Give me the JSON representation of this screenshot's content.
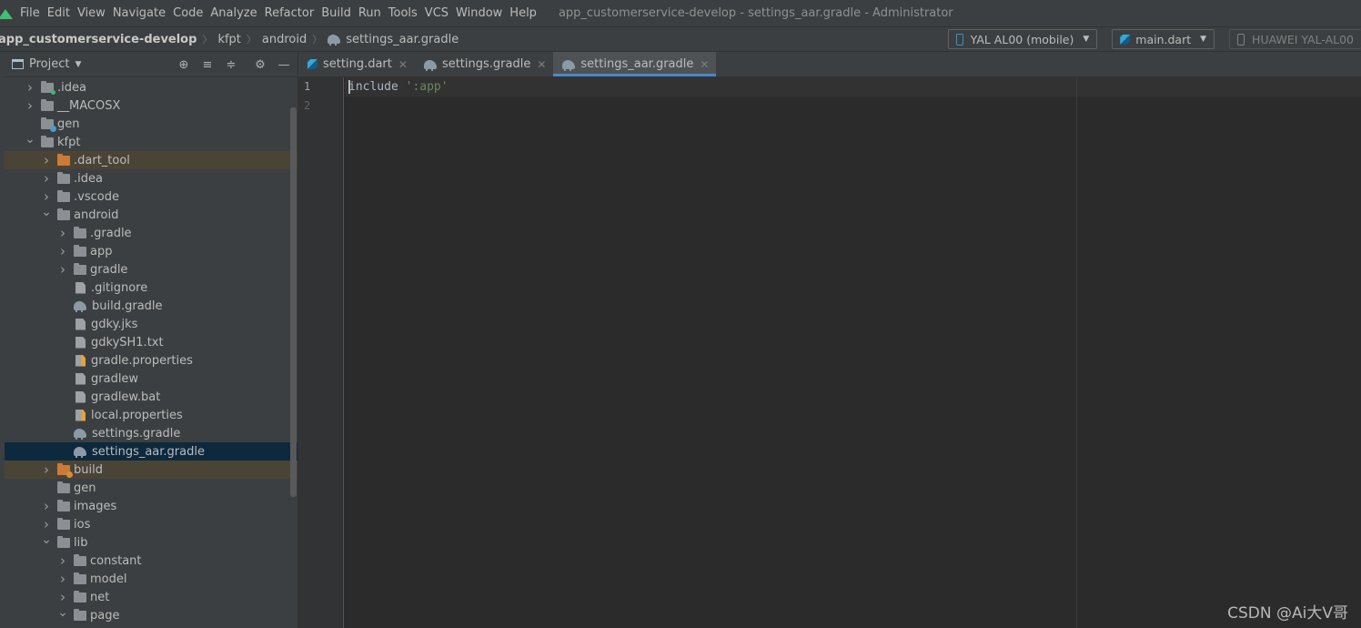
{
  "menubar": {
    "items": [
      "File",
      "Edit",
      "View",
      "Navigate",
      "Code",
      "Analyze",
      "Refactor",
      "Build",
      "Run",
      "Tools",
      "VCS",
      "Window",
      "Help"
    ],
    "window_title": "app_customerservice-develop - settings_aar.gradle - Administrator"
  },
  "navbar": {
    "crumbs": [
      "app_customerservice-develop",
      "kfpt",
      "android",
      "settings_aar.gradle"
    ],
    "device_select": "YAL AL00 (mobile)",
    "run_config": "main.dart",
    "device_label": "HUAWEI YAL-AL00"
  },
  "project_panel": {
    "title": "Project",
    "tree": [
      {
        "label": ".idea",
        "depth": 1,
        "expander": "collapsed",
        "icon": "folder-idea"
      },
      {
        "label": "__MACOSX",
        "depth": 1,
        "expander": "collapsed",
        "icon": "folder"
      },
      {
        "label": "gen",
        "depth": 1,
        "expander": "none",
        "icon": "folder-gen"
      },
      {
        "label": "kfpt",
        "depth": 1,
        "expander": "expanded",
        "icon": "folder"
      },
      {
        "label": ".dart_tool",
        "depth": 2,
        "expander": "collapsed",
        "icon": "folder-orange",
        "highlight": "brown"
      },
      {
        "label": ".idea",
        "depth": 2,
        "expander": "collapsed",
        "icon": "folder"
      },
      {
        "label": ".vscode",
        "depth": 2,
        "expander": "collapsed",
        "icon": "folder"
      },
      {
        "label": "android",
        "depth": 2,
        "expander": "expanded",
        "icon": "folder"
      },
      {
        "label": ".gradle",
        "depth": 3,
        "expander": "collapsed",
        "icon": "folder"
      },
      {
        "label": "app",
        "depth": 3,
        "expander": "collapsed",
        "icon": "folder"
      },
      {
        "label": "gradle",
        "depth": 3,
        "expander": "collapsed",
        "icon": "folder"
      },
      {
        "label": ".gitignore",
        "depth": 3,
        "expander": "none",
        "icon": "file"
      },
      {
        "label": "build.gradle",
        "depth": 3,
        "expander": "none",
        "icon": "gradle"
      },
      {
        "label": "gdky.jks",
        "depth": 3,
        "expander": "none",
        "icon": "file"
      },
      {
        "label": "gdkySH1.txt",
        "depth": 3,
        "expander": "none",
        "icon": "file"
      },
      {
        "label": "gradle.properties",
        "depth": 3,
        "expander": "none",
        "icon": "file-props"
      },
      {
        "label": "gradlew",
        "depth": 3,
        "expander": "none",
        "icon": "file"
      },
      {
        "label": "gradlew.bat",
        "depth": 3,
        "expander": "none",
        "icon": "file"
      },
      {
        "label": "local.properties",
        "depth": 3,
        "expander": "none",
        "icon": "file-props"
      },
      {
        "label": "settings.gradle",
        "depth": 3,
        "expander": "none",
        "icon": "gradle"
      },
      {
        "label": "settings_aar.gradle",
        "depth": 3,
        "expander": "none",
        "icon": "gradle",
        "highlight": "blue"
      },
      {
        "label": "build",
        "depth": 2,
        "expander": "collapsed",
        "icon": "folder-build",
        "highlight": "brown"
      },
      {
        "label": "gen",
        "depth": 2,
        "expander": "none",
        "icon": "folder"
      },
      {
        "label": "images",
        "depth": 2,
        "expander": "collapsed",
        "icon": "folder"
      },
      {
        "label": "ios",
        "depth": 2,
        "expander": "collapsed",
        "icon": "folder"
      },
      {
        "label": "lib",
        "depth": 2,
        "expander": "expanded",
        "icon": "folder"
      },
      {
        "label": "constant",
        "depth": 3,
        "expander": "collapsed",
        "icon": "folder"
      },
      {
        "label": "model",
        "depth": 3,
        "expander": "collapsed",
        "icon": "folder"
      },
      {
        "label": "net",
        "depth": 3,
        "expander": "collapsed",
        "icon": "folder"
      },
      {
        "label": "page",
        "depth": 3,
        "expander": "expanded",
        "icon": "folder"
      }
    ]
  },
  "editor": {
    "tabs": [
      {
        "label": "setting.dart",
        "icon": "dart",
        "active": false
      },
      {
        "label": "settings.gradle",
        "icon": "gradle",
        "active": false
      },
      {
        "label": "settings_aar.gradle",
        "icon": "gradle",
        "active": true
      }
    ],
    "line_numbers": [
      "1",
      "2"
    ],
    "code": {
      "keyword": "include",
      "string": "':app'"
    }
  },
  "watermark": "CSDN @Ai大V哥",
  "colors": {
    "accent": "#4a88c7",
    "selection": "#0d293e",
    "excluded": "#4a4437",
    "string": "#6a8759"
  }
}
